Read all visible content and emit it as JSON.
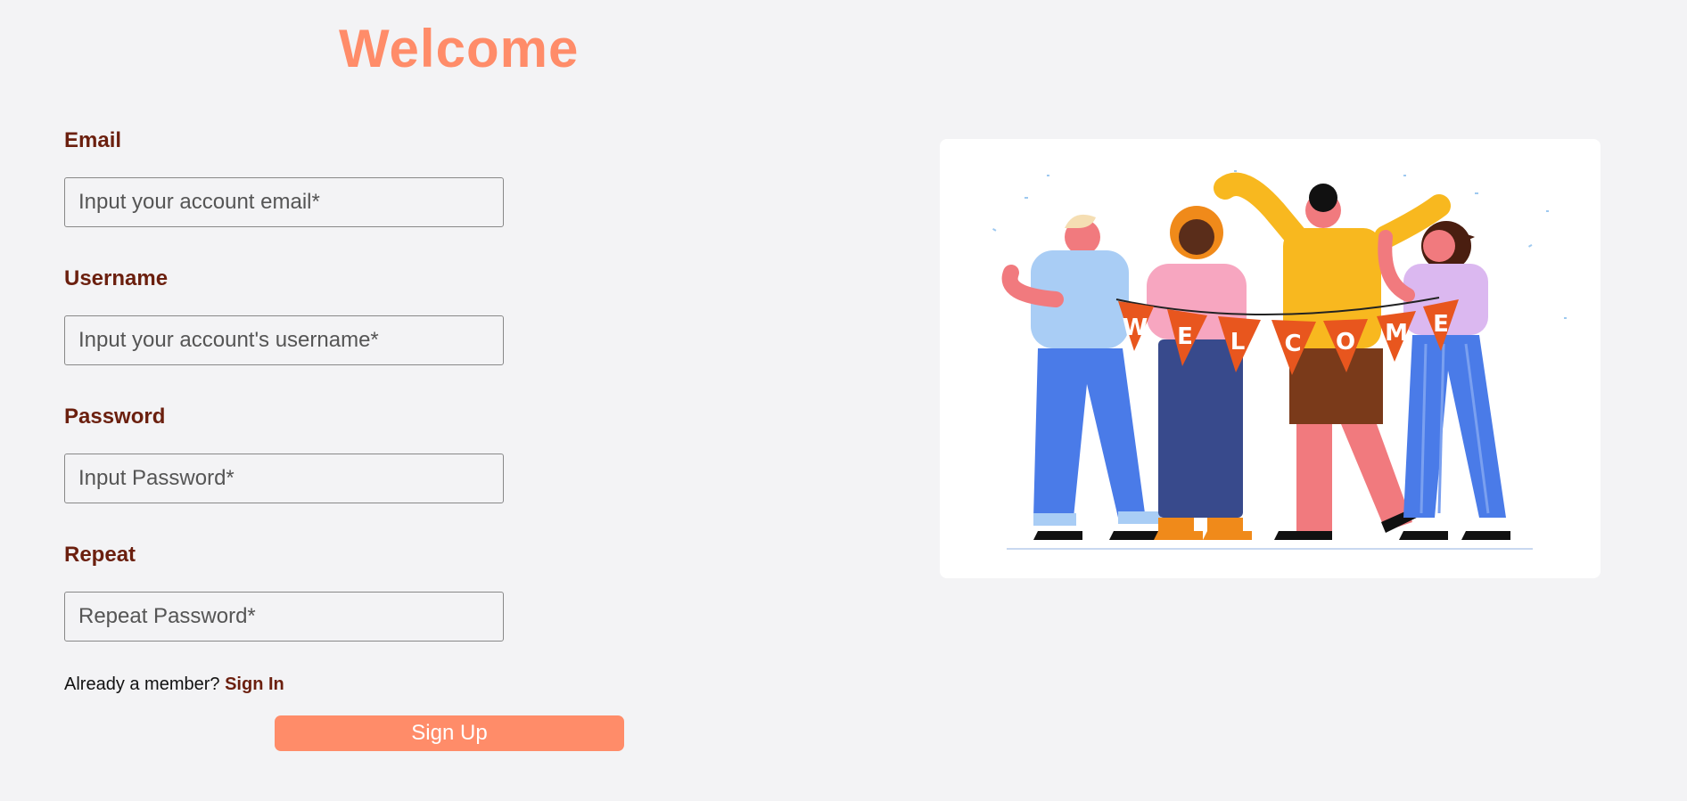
{
  "header": {
    "title": "Welcome"
  },
  "form": {
    "email": {
      "label": "Email",
      "placeholder": "Input your account email*"
    },
    "username": {
      "label": "Username",
      "placeholder": "Input your account's username*"
    },
    "password": {
      "label": "Password",
      "placeholder": "Input Password*"
    },
    "repeat": {
      "label": "Repeat",
      "placeholder": "Repeat Password*"
    },
    "member_prompt": "Already a member?",
    "signin_link": "Sign In",
    "submit_label": "Sign Up"
  },
  "illustration": {
    "banner_letters": [
      "W",
      "E",
      "L",
      "C",
      "O",
      "M",
      "E"
    ]
  },
  "colors": {
    "accent": "#ff8c69",
    "label": "#6b1f0e",
    "background": "#f3f3f5",
    "banner": "#e8561e"
  }
}
